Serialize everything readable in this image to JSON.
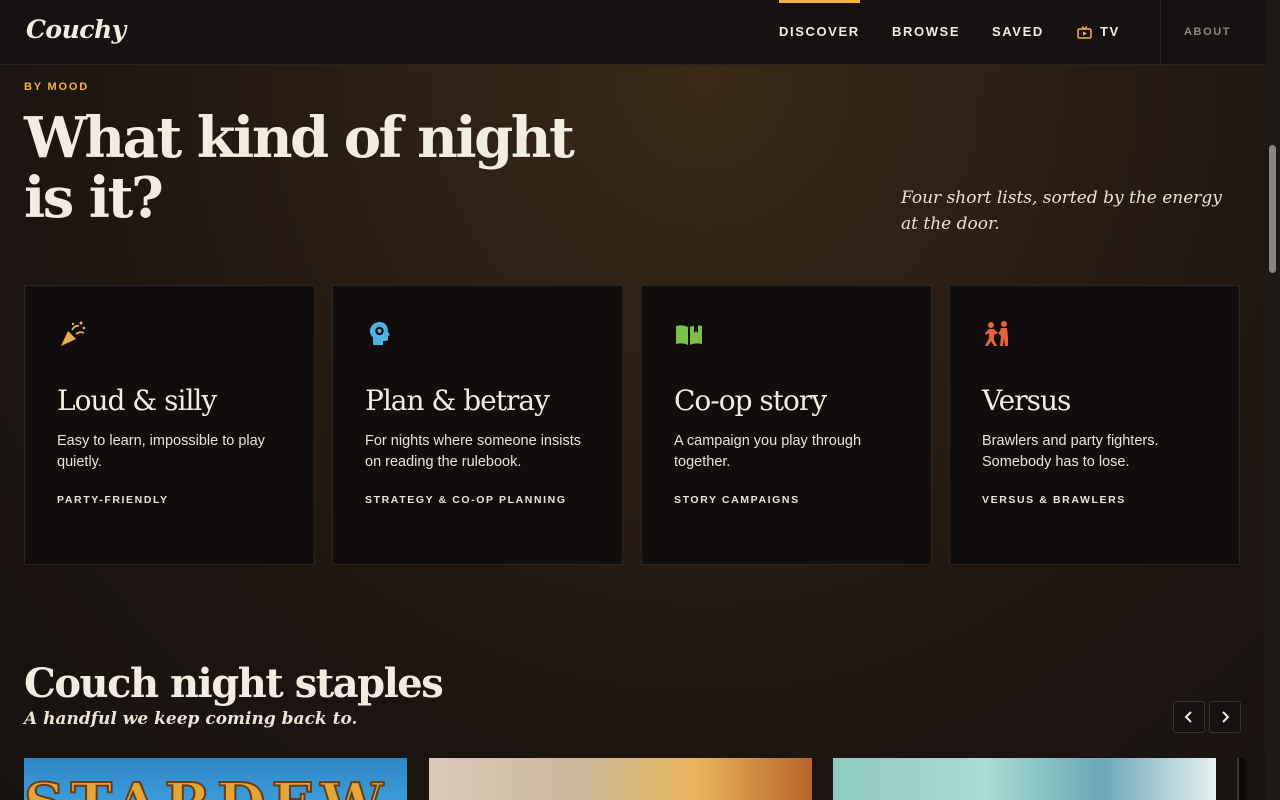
{
  "nav": {
    "logo": "Couchy",
    "links": [
      "DISCOVER",
      "BROWSE",
      "SAVED",
      "TV"
    ],
    "active": "DISCOVER",
    "about": "ABOUT",
    "tv_icon": "tv-icon",
    "accent": "#f2b43c"
  },
  "hero": {
    "eyebrow": "BY MOOD",
    "title": "What kind of night is it?",
    "subtitle": "Four short lists, sorted by the energy at the door."
  },
  "moods": [
    {
      "icon": "party-popper-icon",
      "icon_color": "#e8b04a",
      "title": "Loud & silly",
      "desc": "Easy to learn, impossible to play quietly.",
      "tag": "PARTY-FRIENDLY"
    },
    {
      "icon": "brain-gear-icon",
      "icon_color": "#4fb3e6",
      "title": "Plan & betray",
      "desc": "For nights where someone insists on reading the rulebook.",
      "tag": "STRATEGY & CO-OP PLANNING"
    },
    {
      "icon": "open-book-icon",
      "icon_color": "#7cc04b",
      "title": "Co-op story",
      "desc": "A campaign you play through together.",
      "tag": "STORY CAMPAIGNS"
    },
    {
      "icon": "fighters-icon",
      "icon_color": "#e0633a",
      "title": "Versus",
      "desc": "Brawlers and party fighters. Somebody has to lose.",
      "tag": "VERSUS & BRAWLERS"
    }
  ],
  "staples": {
    "title": "Couch night staples",
    "subtitle": "A handful we keep coming back to.",
    "prev_icon": "chevron-left-icon",
    "next_icon": "chevron-right-icon",
    "first_thumb_text": "STARDEW"
  }
}
